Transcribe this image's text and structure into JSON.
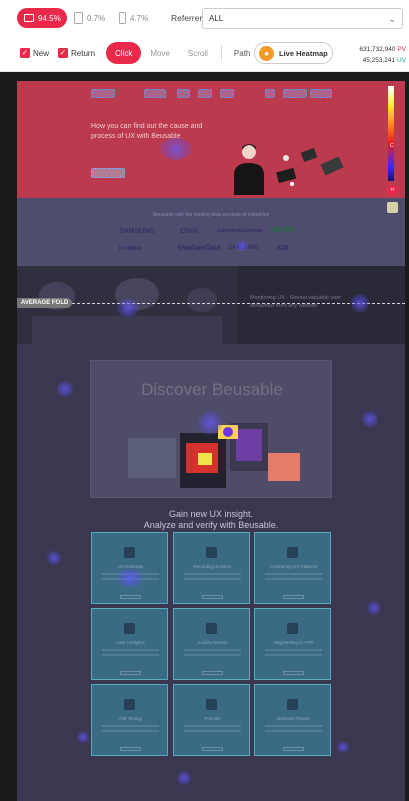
{
  "devices": {
    "desktop": {
      "icon": "monitor-icon",
      "percent": "94.5%"
    },
    "tablet": {
      "icon": "tablet-icon",
      "percent": "0.7%"
    },
    "mobile": {
      "icon": "mobile-icon",
      "percent": "4.7%"
    }
  },
  "referrer": {
    "label": "Referrer",
    "value": "ALL"
  },
  "filters": {
    "new_label": "New",
    "return_label": "Return",
    "new_checked": true,
    "return_checked": true
  },
  "modes": {
    "click": "Click",
    "move": "Move",
    "scroll": "Scroll",
    "path": "Path",
    "active": "Click"
  },
  "live_heatmap": {
    "label": "Live Heatmap",
    "icon": "fire-icon"
  },
  "stats": {
    "pv_value": "631,732,940",
    "pv_label": "PV",
    "uv_value": "45,253,241",
    "uv_label": "UV"
  },
  "page_preview": {
    "hero_text": "How you can find out the cause and process of UX with Beusable",
    "logos_title": "Beusable with the leading data services of industries",
    "logos_row1": [
      "SAMSUNG",
      "Cheil",
      "Johnson&Johnson",
      "NAVER"
    ],
    "logos_row2": [
      "HYUNDAI",
      "ShinhanCard",
      "SAMSUNG",
      "KIA"
    ],
    "band_text": "Monitoring UX · Reveal valuable user behaviour from any website",
    "fold_label": "AVERAGE FOLD",
    "showcase_title": "Discover Beusable",
    "gain_line1": "Gain new UX insight.",
    "gain_line2": "Analyze and verify with Beusable.",
    "cards": [
      {
        "title": "UX Heatmap"
      },
      {
        "title": "Recording Solution"
      },
      {
        "title": "Comparing UX Patterns"
      },
      {
        "title": "User Analytics"
      },
      {
        "title": "Activity Stream"
      },
      {
        "title": "Segmenting to VTR"
      },
      {
        "title": "A/B Testing"
      },
      {
        "title": "Funnels"
      },
      {
        "title": "Behavior Report"
      }
    ]
  },
  "heatmap_scale": {
    "top_label": "H",
    "bottom_label": "C"
  },
  "colors": {
    "accent": "#e8294a",
    "uv": "#2aa6a6",
    "live": "#f09a28"
  }
}
